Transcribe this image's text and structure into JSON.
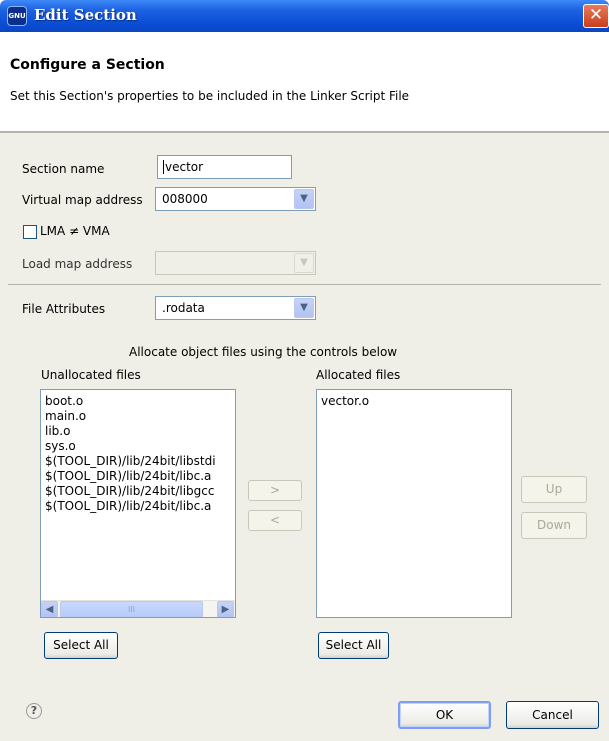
{
  "window": {
    "title": "Edit Section",
    "icon": "gnu-app-icon",
    "icon_text": "GNU",
    "close_label": "✕"
  },
  "header": {
    "title": "Configure a Section",
    "description": "Set this Section's properties to be included in the Linker Script File"
  },
  "form": {
    "section_name_label": "Section name",
    "section_name_value": "vector",
    "virtual_map_label": "Virtual map address",
    "virtual_map_value": "008000",
    "lma_vma_label": "LMA ≠ VMA",
    "lma_vma_checked": false,
    "load_map_label": "Load map address",
    "load_map_value": "",
    "file_attributes_label": "File Attributes",
    "file_attributes_value": ".rodata"
  },
  "allocation": {
    "instruction": "Allocate object files using the controls below",
    "unallocated_label": "Unallocated files",
    "allocated_label": "Allocated files",
    "unallocated_files": [
      "boot.o",
      "main.o",
      "lib.o",
      "sys.o",
      "$(TOOL_DIR)/lib/24bit/libstdi",
      "$(TOOL_DIR)/lib/24bit/libc.a",
      "$(TOOL_DIR)/lib/24bit/libgcc",
      "$(TOOL_DIR)/lib/24bit/libc.a"
    ],
    "allocated_files": [
      "vector.o"
    ],
    "add_label": ">",
    "remove_label": "<",
    "up_label": "Up",
    "down_label": "Down",
    "select_all_left": "Select All",
    "select_all_right": "Select All",
    "scroll_left_glyph": "◀",
    "scroll_right_glyph": "▶",
    "scroll_thumb_glyph": "III"
  },
  "footer": {
    "help_icon": "?",
    "ok_label": "OK",
    "cancel_label": "Cancel"
  },
  "colors": {
    "titlebar": "#0a4fd6",
    "dialog_bg": "#efefe7",
    "field_border": "#7f9db9"
  }
}
